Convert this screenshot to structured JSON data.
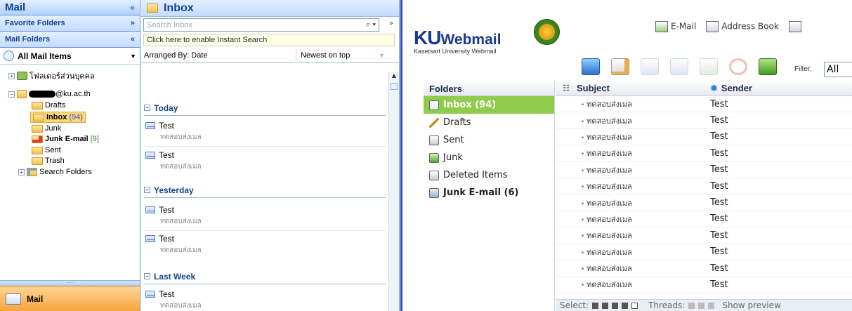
{
  "nav": {
    "title": "Mail",
    "collapse_glyph": "«",
    "favorite_folders": "Favorite Folders",
    "mail_folders": "Mail Folders",
    "all_mail_items": "All Mail Items",
    "personal_folders": "โฟลเดอร์ส่วนบุคคล",
    "account": "@ku.ac.th",
    "folders": [
      {
        "label": "Drafts",
        "count": "",
        "bold": false
      },
      {
        "label": "Inbox",
        "count": "(94)",
        "bold": true
      },
      {
        "label": "Junk",
        "count": "",
        "bold": false
      },
      {
        "label": "Junk E-mail",
        "count": "[9]",
        "bold": true
      },
      {
        "label": "Sent",
        "count": "",
        "bold": false
      },
      {
        "label": "Trash",
        "count": "",
        "bold": false
      }
    ],
    "search_folders": "Search Folders",
    "footer_label": "Mail"
  },
  "inbox": {
    "title": "Inbox",
    "search_placeholder": "Search Inbox",
    "instant_search": "Click here to enable Instant Search",
    "arranged_by": "Arranged By: Date",
    "order": "Newest on top",
    "groups": [
      {
        "label": "Today",
        "messages": [
          {
            "from": "Test",
            "subject": "ทดสอบส่งเมล"
          },
          {
            "from": "Test",
            "subject": "ทดสอบส่งเมล"
          }
        ]
      },
      {
        "label": "Yesterday",
        "messages": [
          {
            "from": "Test",
            "subject": "ทดสอบส่งเมล"
          },
          {
            "from": "Test",
            "subject": "ทดสอบส่งเมล"
          }
        ]
      },
      {
        "label": "Last Week",
        "messages": [
          {
            "from": "Test",
            "subject": "ทดสอบส่งเมล"
          }
        ]
      }
    ]
  },
  "webmail": {
    "logo_ku": "KU",
    "logo_text": "Webmail",
    "logo_sub": "Kasetsart University Webmail",
    "links": {
      "email": "E-Mail",
      "address_book": "Address Book"
    },
    "filter_label": "Filter:",
    "filter_value": "All",
    "folders_header": "Folders",
    "folders": [
      {
        "label": "Inbox (94)",
        "selected": true,
        "bold": true
      },
      {
        "label": "Drafts",
        "selected": false,
        "bold": false
      },
      {
        "label": "Sent",
        "selected": false,
        "bold": false
      },
      {
        "label": "Junk",
        "selected": false,
        "bold": false
      },
      {
        "label": "Deleted Items",
        "selected": false,
        "bold": false
      },
      {
        "label": "Junk E-mail (6)",
        "selected": false,
        "bold": true
      }
    ],
    "subject_header": "Subject",
    "sender_header": "Sender",
    "messages": [
      {
        "subject": "ทดสอบส่งเมล",
        "sender": "Test"
      },
      {
        "subject": "ทดสอบส่งเมล",
        "sender": "Test"
      },
      {
        "subject": "ทดสอบส่งเมล",
        "sender": "Test"
      },
      {
        "subject": "ทดสอบส่งเมล",
        "sender": "Test"
      },
      {
        "subject": "ทดสอบส่งเมล",
        "sender": "Test"
      },
      {
        "subject": "ทดสอบส่งเมล",
        "sender": "Test"
      },
      {
        "subject": "ทดสอบส่งเมล",
        "sender": "Test"
      },
      {
        "subject": "ทดสอบส่งเมล",
        "sender": "Test"
      },
      {
        "subject": "ทดสอบส่งเมล",
        "sender": "Test"
      },
      {
        "subject": "ทดสอบส่งเมล",
        "sender": "Test"
      },
      {
        "subject": "ทดสอบส่งเมล",
        "sender": "Test"
      },
      {
        "subject": "ทดสอบส่งเมล",
        "sender": "Test"
      }
    ],
    "footer": {
      "select": "Select:",
      "threads": "Threads:",
      "preview": "Show preview"
    }
  }
}
